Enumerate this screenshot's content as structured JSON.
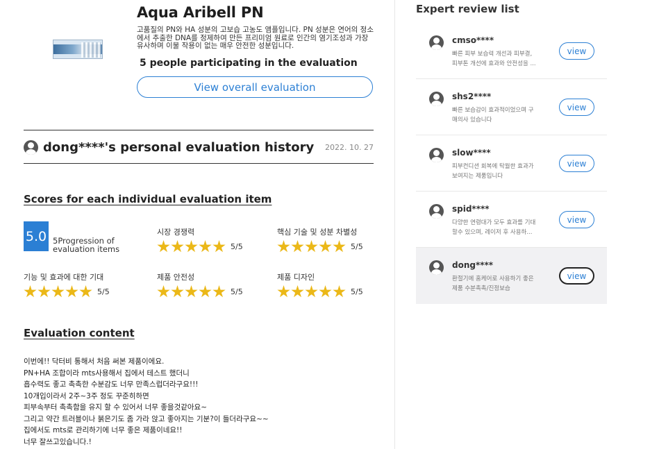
{
  "product": {
    "title": "Aqua Aribell PN",
    "description": "고품질의 PN와 HA 성분의 고보습 고농도 앰플입니다. PN 성분은 연어의 정소에서 추출한 DNA를 정제하여 만든 프리미엄 원료로 인간의 염기조성과 가장 유사하며 이물 작용이 없는 매우 안전한 성분입니다.",
    "participants": "5 people participating in the evaluation",
    "view_overall_label": "View overall evaluation",
    "image_icon": "product-image"
  },
  "history": {
    "title": "dong****'s personal evaluation history",
    "date": "2022. 10. 27",
    "avatar_icon": "user-avatar-icon"
  },
  "scores": {
    "heading": "Scores for each individual evaluation item",
    "overall": "5.0",
    "overall_caption": "5Progression of evaluation items",
    "accent_color": "#2b7fd4",
    "star_color": "#ebb818",
    "items": [
      {
        "label": "시장 경쟁력",
        "score_text": "5/5",
        "stars": 5
      },
      {
        "label": "핵심 기술 및 성분 차별성",
        "score_text": "5/5",
        "stars": 5
      },
      {
        "label": "기능 및 효과에 대한 기대",
        "score_text": "5/5",
        "stars": 5
      },
      {
        "label": "제품 안전성",
        "score_text": "5/5",
        "stars": 5
      },
      {
        "label": "제품 디자인",
        "score_text": "5/5",
        "stars": 5
      }
    ]
  },
  "evaluation": {
    "heading": "Evaluation content",
    "lines": [
      "이번에!! 닥터비 통해서 처음 써본 제품이에요.",
      "PN+HA 조합이라 mts사용해서 집에서 테스트 했더니",
      "흡수력도 좋고 촉촉한 수분감도 너무 만족스럽더라구요!!!",
      "10개입이라서 2주~3주 정도 꾸준히하면",
      "피부속부터 촉촉함을 유지 할 수 있어서 너무 좋을것같아요~",
      "그리고 약간 트러블이나 붉은기도 좀 가라 앉고 좋아지는 기분?이 들더라구요~~",
      "집에서도 mts로 관리하기에 너무 좋은 제품이네요!!",
      "너무 잘쓰고있습니다.!"
    ]
  },
  "experts": {
    "title": "Expert review list",
    "button_label": "view",
    "reviews": [
      {
        "user": "cmso****",
        "lines": [
          "빠른 피부 보습력 개선과 피부결,",
          "피부톤 개선에 효과와 안전성을 ..."
        ],
        "active": false
      },
      {
        "user": "shs2****",
        "lines": [
          "빠른 보습감이 효과적이었으며 구",
          "매의사 있습니다"
        ],
        "active": false
      },
      {
        "user": "slow****",
        "lines": [
          "피부컨디션 회복에 탁월한 효과가",
          "보여지는 제품입니다"
        ],
        "active": false
      },
      {
        "user": "spid****",
        "lines": [
          "다양한 연령대가 모두 효과를 기대",
          "할수 있으며, 레이저 후 사용하..."
        ],
        "active": false
      },
      {
        "user": "dong****",
        "lines": [
          "환절기에 홈케어로 사용하기 좋은",
          "제품 수분촉촉/진정보습"
        ],
        "active": true
      }
    ]
  }
}
